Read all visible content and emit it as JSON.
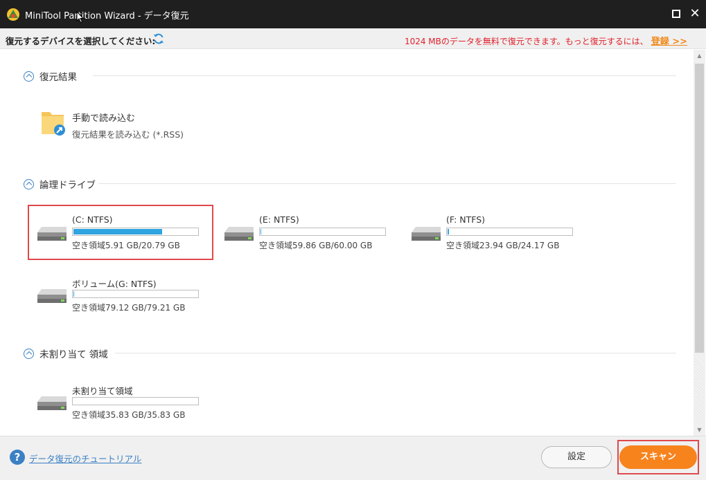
{
  "window": {
    "title": "MiniTool Partition Wizard - データ復元",
    "maximize_label": "□",
    "close_label": "✕"
  },
  "subheader": {
    "prompt": "復元するデバイスを選択してください:",
    "notice": "1024 MBのデータを無料で復元できます。もっと復元するには、",
    "register_link": "登録 >>"
  },
  "sections": {
    "recovery_result": {
      "title": "復元結果",
      "load_item": {
        "title": "手動で読み込む",
        "subtitle": "復元結果を読み込む (*.RSS)"
      }
    },
    "logical_drives": {
      "title": "論理ドライブ",
      "drives": [
        {
          "name": "(C: NTFS)",
          "free": "空き領域5.91 GB/20.79 GB",
          "used_fraction": 0.716,
          "selected": true
        },
        {
          "name": "(E: NTFS)",
          "free": "空き領域59.86 GB/60.00 GB",
          "used_fraction": 0.002,
          "selected": false
        },
        {
          "name": "(F: NTFS)",
          "free": "空き領域23.94 GB/24.17 GB",
          "used_fraction": 0.01,
          "selected": false
        },
        {
          "name": "ボリューム(G: NTFS)",
          "free": "空き領域79.12 GB/79.21 GB",
          "used_fraction": 0.001,
          "selected": false
        }
      ]
    },
    "unallocated": {
      "title": "未割り当て 領域",
      "drives": [
        {
          "name": "未割り当て領域",
          "free": "空き領域35.83 GB/35.83 GB",
          "used_fraction": 0.0
        }
      ]
    }
  },
  "footer": {
    "help_label": "?",
    "tutorial_link": "データ復元のチュートリアル",
    "settings_button": "設定",
    "scan_button": "スキャン"
  },
  "colors": {
    "titlebar": "#1f1f1f",
    "accent_blue": "#2fa4e0",
    "link_blue": "#3a80c4",
    "notice_red": "#e0202a",
    "register_orange": "#f08a1c",
    "scan_orange": "#f7831d",
    "highlight_red": "#e0484c"
  }
}
